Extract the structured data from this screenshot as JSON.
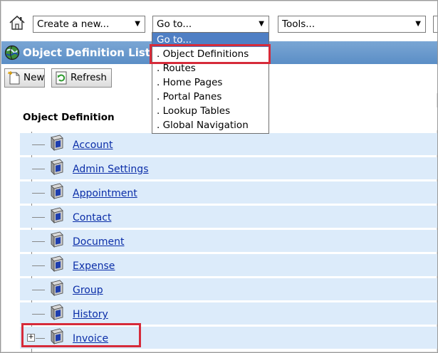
{
  "toolbar": {
    "create_new": "Create a new...",
    "goto": "Go to...",
    "tools": "Tools..."
  },
  "goto_menu": {
    "options": [
      {
        "label": "Go to..."
      },
      {
        "label": ". Object Definitions"
      },
      {
        "label": ". Routes"
      },
      {
        "label": ". Home Pages"
      },
      {
        "label": ". Portal Panes"
      },
      {
        "label": ". Lookup Tables"
      },
      {
        "label": ". Global Navigation"
      }
    ]
  },
  "title_bar": {
    "title": "Object Definition List"
  },
  "actions": {
    "new_label": "New",
    "refresh_label": "Refresh"
  },
  "list": {
    "header": "Object Definition",
    "items": [
      {
        "label": "Account"
      },
      {
        "label": "Admin Settings"
      },
      {
        "label": "Appointment"
      },
      {
        "label": "Contact"
      },
      {
        "label": "Document"
      },
      {
        "label": "Expense"
      },
      {
        "label": "Group"
      },
      {
        "label": "History"
      },
      {
        "label": "Invoice"
      }
    ]
  },
  "colors": {
    "title_bar": "#5b8ec6",
    "row_bg": "#dcebfa",
    "link": "#0b2ea8",
    "selected_option": "#4f7fc4",
    "highlight": "#d62b3a"
  }
}
